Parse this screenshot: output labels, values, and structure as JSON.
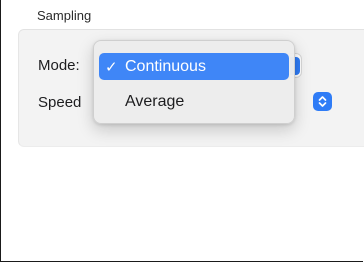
{
  "group": {
    "title": "Sampling"
  },
  "fields": {
    "mode_label": "Mode:",
    "speed_label": "Speed"
  },
  "mode_menu": {
    "check_glyph": "✓",
    "items": [
      {
        "label": "Continuous",
        "selected": true
      },
      {
        "label": "Average",
        "selected": false
      }
    ]
  },
  "icons": {
    "checkmark": "checkmark-icon",
    "stepper": "up-down-chevron-icon"
  },
  "colors": {
    "accent": "#3f86f7",
    "menu_background": "#ececec",
    "group_background": "#f3f3f3"
  }
}
